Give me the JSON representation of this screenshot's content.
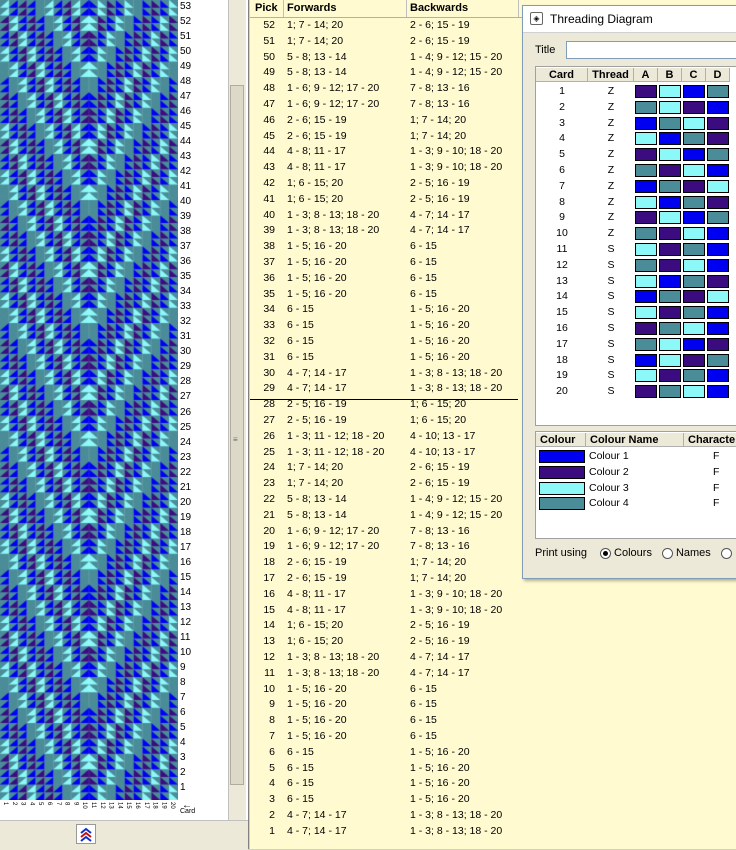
{
  "colors": {
    "colour1": "#0000f0",
    "colour2": "#3a0c80",
    "colour3": "#8cf8f8",
    "colour4": "#4a8c98"
  },
  "pattern": {
    "row_numbers": [
      "53",
      "52",
      "51",
      "50",
      "49",
      "48",
      "47",
      "46",
      "45",
      "44",
      "43",
      "42",
      "41",
      "40",
      "39",
      "38",
      "37",
      "36",
      "35",
      "34",
      "33",
      "32",
      "31",
      "30",
      "29",
      "28",
      "27",
      "26",
      "25",
      "24",
      "23",
      "22",
      "21",
      "20",
      "19",
      "18",
      "17",
      "16",
      "15",
      "14",
      "13",
      "12",
      "11",
      "10",
      "9",
      "8",
      "7",
      "6",
      "5",
      "4",
      "3",
      "2",
      "1"
    ],
    "card_labels": [
      "1",
      "2",
      "3",
      "4",
      "5",
      "6",
      "7",
      "8",
      "9",
      "10",
      "11",
      "12",
      "13",
      "14",
      "15",
      "16",
      "17",
      "18",
      "19",
      "20"
    ],
    "card_axis_label": "Card"
  },
  "table": {
    "headers": {
      "pick": "Pick",
      "forwards": "Forwards",
      "backwards": "Backwards"
    },
    "rows": [
      {
        "pick": "52",
        "fw": "1; 7 - 14; 20",
        "bw": "2 - 6; 15 - 19"
      },
      {
        "pick": "51",
        "fw": "1; 7 - 14; 20",
        "bw": "2 - 6; 15 - 19"
      },
      {
        "pick": "50",
        "fw": "5 - 8; 13 - 14",
        "bw": "1 - 4; 9 - 12; 15 - 20"
      },
      {
        "pick": "49",
        "fw": "5 - 8; 13 - 14",
        "bw": "1 - 4; 9 - 12; 15 - 20"
      },
      {
        "pick": "48",
        "fw": "1 - 6; 9 - 12; 17 - 20",
        "bw": "7 - 8; 13 - 16"
      },
      {
        "pick": "47",
        "fw": "1 - 6; 9 - 12; 17 - 20",
        "bw": "7 - 8; 13 - 16"
      },
      {
        "pick": "46",
        "fw": "2 - 6; 15 - 19",
        "bw": "1; 7 - 14; 20"
      },
      {
        "pick": "45",
        "fw": "2 - 6; 15 - 19",
        "bw": "1; 7 - 14; 20"
      },
      {
        "pick": "44",
        "fw": "4 - 8; 11 - 17",
        "bw": "1 - 3; 9 - 10; 18 - 20"
      },
      {
        "pick": "43",
        "fw": "4 - 8; 11 - 17",
        "bw": "1 - 3; 9 - 10; 18 - 20"
      },
      {
        "pick": "42",
        "fw": "1; 6 - 15; 20",
        "bw": "2 - 5; 16 - 19"
      },
      {
        "pick": "41",
        "fw": "1; 6 - 15; 20",
        "bw": "2 - 5; 16 - 19"
      },
      {
        "pick": "40",
        "fw": "1 - 3; 8 - 13; 18 - 20",
        "bw": "4 - 7; 14 - 17"
      },
      {
        "pick": "39",
        "fw": "1 - 3; 8 - 13; 18 - 20",
        "bw": "4 - 7; 14 - 17"
      },
      {
        "pick": "38",
        "fw": "1 - 5; 16 - 20",
        "bw": "6 - 15"
      },
      {
        "pick": "37",
        "fw": "1 - 5; 16 - 20",
        "bw": "6 - 15"
      },
      {
        "pick": "36",
        "fw": "1 - 5; 16 - 20",
        "bw": "6 - 15"
      },
      {
        "pick": "35",
        "fw": "1 - 5; 16 - 20",
        "bw": "6 - 15"
      },
      {
        "pick": "34",
        "fw": "6 - 15",
        "bw": "1 - 5; 16 - 20"
      },
      {
        "pick": "33",
        "fw": "6 - 15",
        "bw": "1 - 5; 16 - 20"
      },
      {
        "pick": "32",
        "fw": "6 - 15",
        "bw": "1 - 5; 16 - 20"
      },
      {
        "pick": "31",
        "fw": "6 - 15",
        "bw": "1 - 5; 16 - 20"
      },
      {
        "pick": "30",
        "fw": "4 - 7; 14 - 17",
        "bw": "1 - 3; 8 - 13; 18 - 20"
      },
      {
        "pick": "29",
        "fw": "4 - 7; 14 - 17",
        "bw": "1 - 3; 8 - 13; 18 - 20"
      },
      {
        "pick": "28",
        "fw": "2 - 5; 16 - 19",
        "bw": "1; 6 - 15; 20"
      },
      {
        "pick": "27",
        "fw": "2 - 5; 16 - 19",
        "bw": "1; 6 - 15; 20"
      },
      {
        "pick": "26",
        "fw": "1 - 3; 11 - 12; 18 - 20",
        "bw": "4 - 10; 13 - 17"
      },
      {
        "pick": "25",
        "fw": "1 - 3; 11 - 12; 18 - 20",
        "bw": "4 - 10; 13 - 17"
      },
      {
        "pick": "24",
        "fw": "1; 7 - 14; 20",
        "bw": "2 - 6; 15 - 19"
      },
      {
        "pick": "23",
        "fw": "1; 7 - 14; 20",
        "bw": "2 - 6; 15 - 19"
      },
      {
        "pick": "22",
        "fw": "5 - 8; 13 - 14",
        "bw": "1 - 4; 9 - 12; 15 - 20"
      },
      {
        "pick": "21",
        "fw": "5 - 8; 13 - 14",
        "bw": "1 - 4; 9 - 12; 15 - 20"
      },
      {
        "pick": "20",
        "fw": "1 - 6; 9 - 12; 17 - 20",
        "bw": "7 - 8; 13 - 16"
      },
      {
        "pick": "19",
        "fw": "1 - 6; 9 - 12; 17 - 20",
        "bw": "7 - 8; 13 - 16"
      },
      {
        "pick": "18",
        "fw": "2 - 6; 15 - 19",
        "bw": "1; 7 - 14; 20"
      },
      {
        "pick": "17",
        "fw": "2 - 6; 15 - 19",
        "bw": "1; 7 - 14; 20"
      },
      {
        "pick": "16",
        "fw": "4 - 8; 11 - 17",
        "bw": "1 - 3; 9 - 10; 18 - 20"
      },
      {
        "pick": "15",
        "fw": "4 - 8; 11 - 17",
        "bw": "1 - 3; 9 - 10; 18 - 20"
      },
      {
        "pick": "14",
        "fw": "1; 6 - 15; 20",
        "bw": "2 - 5; 16 - 19"
      },
      {
        "pick": "13",
        "fw": "1; 6 - 15; 20",
        "bw": "2 - 5; 16 - 19"
      },
      {
        "pick": "12",
        "fw": "1 - 3; 8 - 13; 18 - 20",
        "bw": "4 - 7; 14 - 17"
      },
      {
        "pick": "11",
        "fw": "1 - 3; 8 - 13; 18 - 20",
        "bw": "4 - 7; 14 - 17"
      },
      {
        "pick": "10",
        "fw": "1 - 5; 16 - 20",
        "bw": "6 - 15"
      },
      {
        "pick": "9",
        "fw": "1 - 5; 16 - 20",
        "bw": "6 - 15"
      },
      {
        "pick": "8",
        "fw": "1 - 5; 16 - 20",
        "bw": "6 - 15"
      },
      {
        "pick": "7",
        "fw": "1 - 5; 16 - 20",
        "bw": "6 - 15"
      },
      {
        "pick": "6",
        "fw": "6 - 15",
        "bw": "1 - 5; 16 - 20"
      },
      {
        "pick": "5",
        "fw": "6 - 15",
        "bw": "1 - 5; 16 - 20"
      },
      {
        "pick": "4",
        "fw": "6 - 15",
        "bw": "1 - 5; 16 - 20"
      },
      {
        "pick": "3",
        "fw": "6 - 15",
        "bw": "1 - 5; 16 - 20"
      },
      {
        "pick": "2",
        "fw": "4 - 7; 14 - 17",
        "bw": "1 - 3; 8 - 13; 18 - 20"
      },
      {
        "pick": "1",
        "fw": "4 - 7; 14 - 17",
        "bw": "1 - 3; 8 - 13; 18 - 20"
      }
    ]
  },
  "threading": {
    "window_title": "Threading Diagram",
    "title_label": "Title",
    "title_value": "",
    "card_headers": [
      "Card",
      "Thread",
      "A",
      "B",
      "C",
      "D"
    ],
    "cards": [
      {
        "card": "1",
        "thread": "Z",
        "holes": [
          2,
          3,
          1,
          4
        ]
      },
      {
        "card": "2",
        "thread": "Z",
        "holes": [
          4,
          3,
          2,
          1
        ]
      },
      {
        "card": "3",
        "thread": "Z",
        "holes": [
          1,
          4,
          3,
          2
        ]
      },
      {
        "card": "4",
        "thread": "Z",
        "holes": [
          3,
          1,
          4,
          2
        ]
      },
      {
        "card": "5",
        "thread": "Z",
        "holes": [
          2,
          3,
          1,
          4
        ]
      },
      {
        "card": "6",
        "thread": "Z",
        "holes": [
          4,
          2,
          3,
          1
        ]
      },
      {
        "card": "7",
        "thread": "Z",
        "holes": [
          1,
          4,
          2,
          3
        ]
      },
      {
        "card": "8",
        "thread": "Z",
        "holes": [
          3,
          1,
          4,
          2
        ]
      },
      {
        "card": "9",
        "thread": "Z",
        "holes": [
          2,
          3,
          1,
          4
        ]
      },
      {
        "card": "10",
        "thread": "Z",
        "holes": [
          4,
          2,
          3,
          1
        ]
      },
      {
        "card": "11",
        "thread": "S",
        "holes": [
          3,
          2,
          4,
          1
        ]
      },
      {
        "card": "12",
        "thread": "S",
        "holes": [
          4,
          2,
          3,
          1
        ]
      },
      {
        "card": "13",
        "thread": "S",
        "holes": [
          3,
          1,
          4,
          2
        ]
      },
      {
        "card": "14",
        "thread": "S",
        "holes": [
          1,
          4,
          2,
          3
        ]
      },
      {
        "card": "15",
        "thread": "S",
        "holes": [
          3,
          2,
          4,
          1
        ]
      },
      {
        "card": "16",
        "thread": "S",
        "holes": [
          2,
          4,
          3,
          1
        ]
      },
      {
        "card": "17",
        "thread": "S",
        "holes": [
          4,
          3,
          1,
          2
        ]
      },
      {
        "card": "18",
        "thread": "S",
        "holes": [
          1,
          3,
          2,
          4
        ]
      },
      {
        "card": "19",
        "thread": "S",
        "holes": [
          3,
          2,
          4,
          1
        ]
      },
      {
        "card": "20",
        "thread": "S",
        "holes": [
          2,
          4,
          3,
          1
        ]
      }
    ],
    "colour_headers": [
      "Colour",
      "Colour Name",
      "Characte"
    ],
    "colours": [
      {
        "name": "Colour 1",
        "char": "F",
        "key": "colour1"
      },
      {
        "name": "Colour 2",
        "char": "F",
        "key": "colour2"
      },
      {
        "name": "Colour 3",
        "char": "F",
        "key": "colour3"
      },
      {
        "name": "Colour 4",
        "char": "F",
        "key": "colour4"
      }
    ],
    "print_label": "Print using",
    "print_options": [
      "Colours",
      "Names",
      ""
    ],
    "print_selected": "Colours"
  }
}
